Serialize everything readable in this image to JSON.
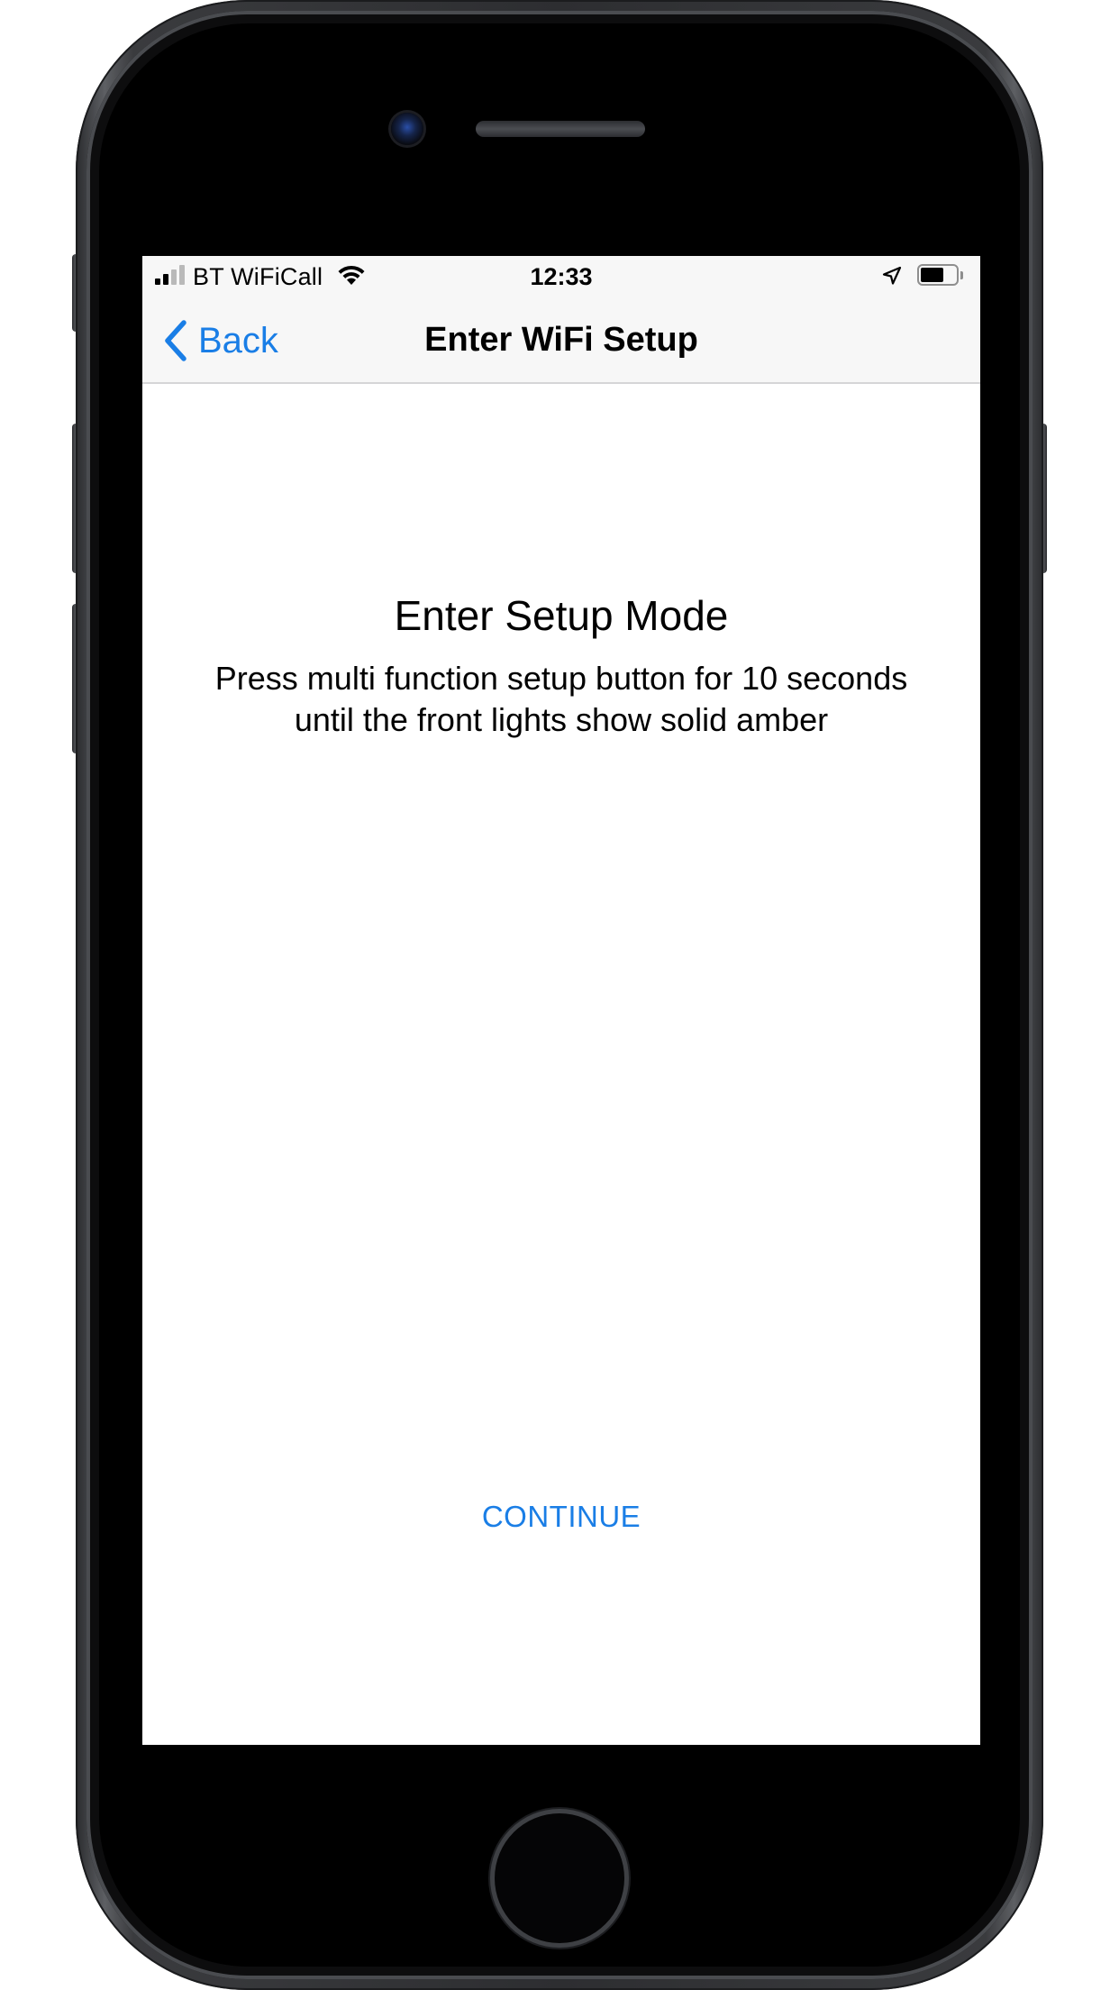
{
  "status_bar": {
    "carrier": "BT WiFiCall",
    "time": "12:33",
    "signal_bars_filled": 2,
    "signal_bars_total": 4,
    "battery_level": 0.65
  },
  "nav": {
    "back_label": "Back",
    "title": "Enter WiFi Setup"
  },
  "content": {
    "heading": "Enter Setup Mode",
    "body_line1": "Press multi function setup button for 10 seconds",
    "body_line2": "until the front lights show solid amber"
  },
  "actions": {
    "continue_label": "CONTINUE"
  },
  "colors": {
    "accent": "#1a7ee6",
    "nav_background": "#f7f7f7",
    "device_frame": "#2d2e31"
  },
  "icons": {
    "back": "chevron-left-icon",
    "wifi": "wifi-icon",
    "location": "location-arrow-icon",
    "battery": "battery-icon",
    "signal": "signal-bars-icon"
  }
}
